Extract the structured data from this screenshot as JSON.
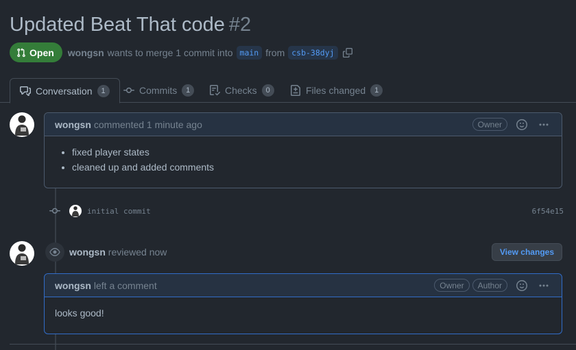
{
  "pr": {
    "title": "Updated Beat That code",
    "number": "#2",
    "state": "Open",
    "author": "wongsn",
    "merge_text": "wants to merge 1 commit into",
    "base_branch": "main",
    "from_text": "from",
    "head_branch": "csb-38dyj"
  },
  "tabs": [
    {
      "label": "Conversation",
      "count": "1",
      "icon": "comment-discussion-icon"
    },
    {
      "label": "Commits",
      "count": "1",
      "icon": "git-commit-icon"
    },
    {
      "label": "Checks",
      "count": "0",
      "icon": "checklist-icon"
    },
    {
      "label": "Files changed",
      "count": "1",
      "icon": "file-diff-icon"
    }
  ],
  "first_comment": {
    "author": "wongsn",
    "action": "commented 1 minute ago",
    "label": "Owner",
    "items": [
      "fixed player states",
      "cleaned up and added comments"
    ]
  },
  "commit": {
    "message": "initial commit",
    "sha": "6f54e15"
  },
  "review": {
    "author": "wongsn",
    "action": "reviewed now",
    "button": "View changes"
  },
  "review_comment": {
    "author": "wongsn",
    "action": "left a comment",
    "labels": [
      "Owner",
      "Author"
    ],
    "body": "looks good!"
  },
  "colors": {
    "background": "#22272e",
    "open_badge": "#347d39",
    "accent": "#539bf5",
    "review_border": "#316dca"
  }
}
